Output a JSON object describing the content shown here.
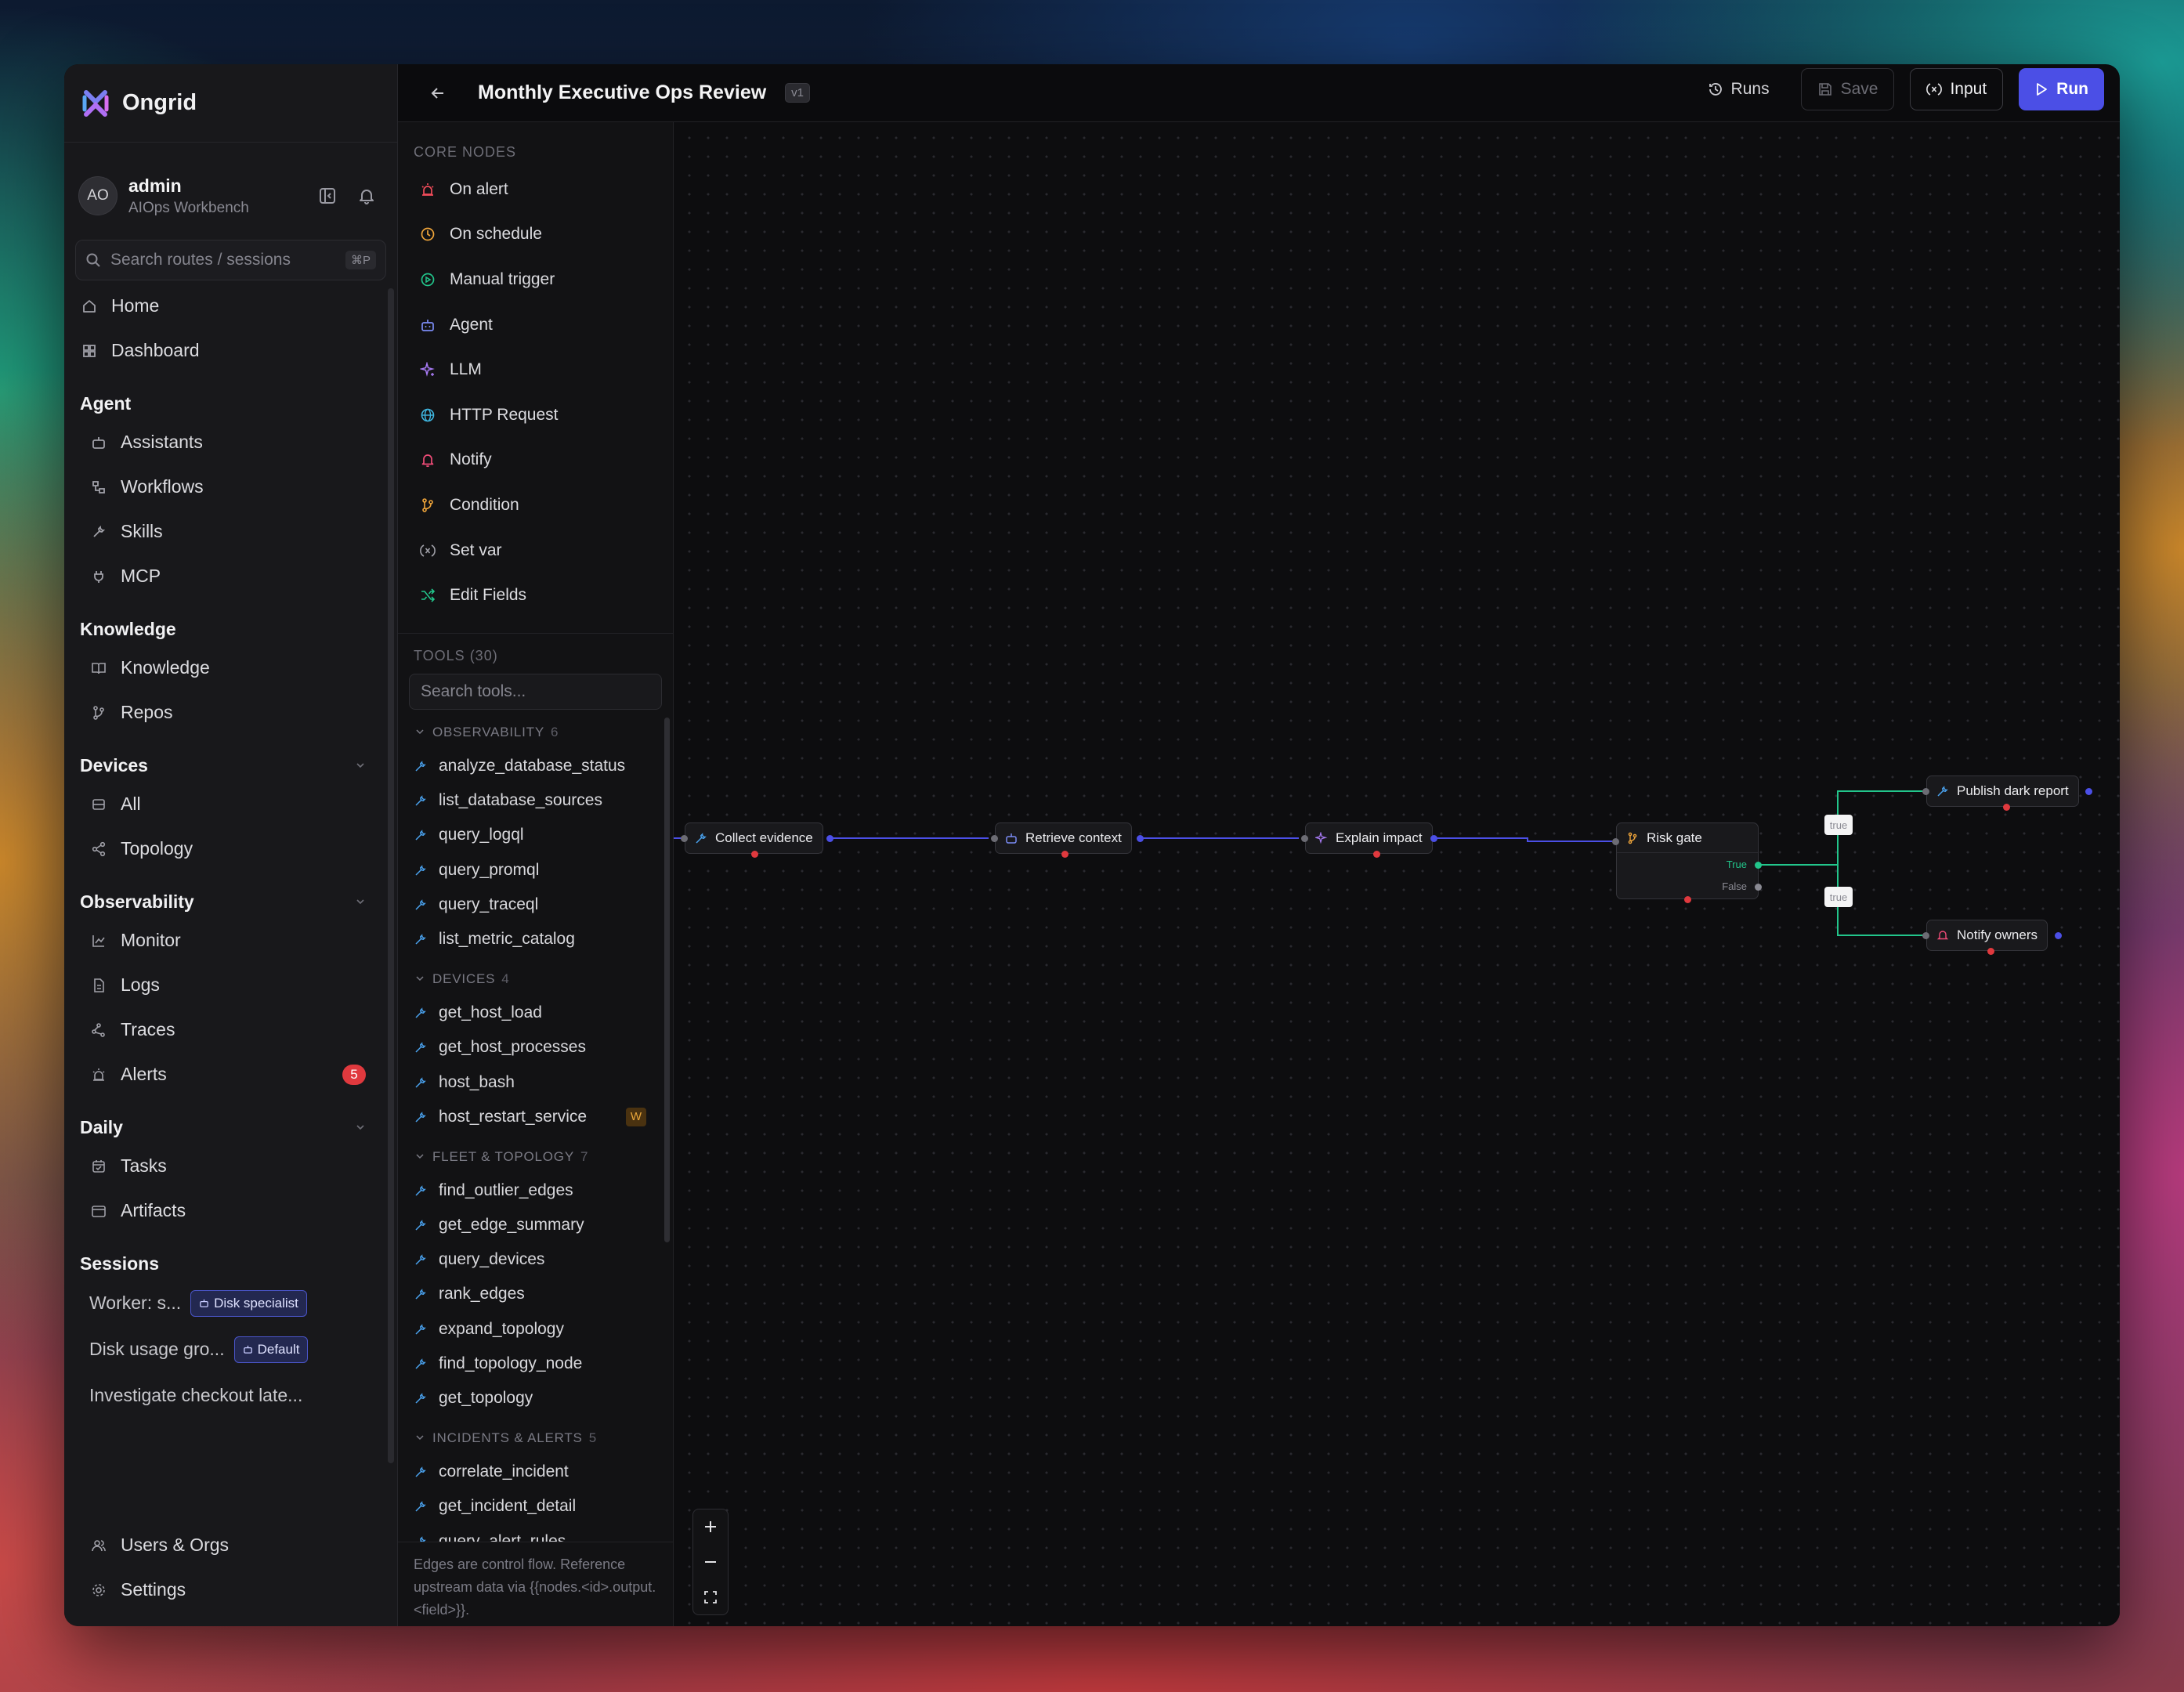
{
  "app": {
    "brand": "Ongrid"
  },
  "user": {
    "initials": "AO",
    "name": "admin",
    "org": "AIOps Workbench"
  },
  "search": {
    "placeholder": "Search routes / sessions",
    "shortcut": "⌘P"
  },
  "nav": {
    "home": "Home",
    "dashboard": "Dashboard",
    "agent_head": "Agent",
    "assistants": "Assistants",
    "workflows": "Workflows",
    "skills": "Skills",
    "mcp": "MCP",
    "knowledge_head": "Knowledge",
    "knowledge": "Knowledge",
    "repos": "Repos",
    "devices_head": "Devices",
    "all": "All",
    "topology": "Topology",
    "observability_head": "Observability",
    "monitor": "Monitor",
    "logs": "Logs",
    "traces": "Traces",
    "alerts": "Alerts",
    "alerts_count": "5",
    "daily_head": "Daily",
    "tasks": "Tasks",
    "artifacts": "Artifacts",
    "sessions_head": "Sessions",
    "users_orgs": "Users & Orgs",
    "settings": "Settings"
  },
  "sessions": [
    {
      "title": "Worker: s...",
      "tag": "Disk specialist"
    },
    {
      "title": "Disk usage gro...",
      "tag": "Default"
    },
    {
      "title": "Investigate checkout late...",
      "tag": ""
    }
  ],
  "workflow": {
    "title": "Monthly Executive Ops Review",
    "version": "v1"
  },
  "toolbar": {
    "runs": "Runs",
    "save": "Save",
    "input": "Input",
    "run": "Run"
  },
  "palette": {
    "core_label": "CORE NODES",
    "core": [
      {
        "label": "On alert",
        "icon": "siren-icon"
      },
      {
        "label": "On schedule",
        "icon": "clock-icon"
      },
      {
        "label": "Manual trigger",
        "icon": "play-circle-icon"
      },
      {
        "label": "Agent",
        "icon": "bot-icon"
      },
      {
        "label": "LLM",
        "icon": "sparkles-icon"
      },
      {
        "label": "HTTP Request",
        "icon": "globe-icon"
      },
      {
        "label": "Notify",
        "icon": "bell-icon"
      },
      {
        "label": "Condition",
        "icon": "git-branch-icon"
      },
      {
        "label": "Set var",
        "icon": "variable-icon"
      },
      {
        "label": "Edit Fields",
        "icon": "shuffle-icon"
      }
    ],
    "tools_label": "TOOLS (30)",
    "tools_search_placeholder": "Search tools...",
    "groups": [
      {
        "name": "OBSERVABILITY",
        "count": "6",
        "tools": [
          "analyze_database_status",
          "list_database_sources",
          "query_logql",
          "query_promql",
          "query_traceql",
          "list_metric_catalog"
        ]
      },
      {
        "name": "DEVICES",
        "count": "4",
        "tools": [
          "get_host_load",
          "get_host_processes",
          "host_bash",
          "host_restart_service"
        ],
        "warn_tool": "W"
      },
      {
        "name": "FLEET & TOPOLOGY",
        "count": "7",
        "tools": [
          "find_outlier_edges",
          "get_edge_summary",
          "query_devices",
          "rank_edges",
          "expand_topology",
          "find_topology_node",
          "get_topology"
        ]
      },
      {
        "name": "INCIDENTS & ALERTS",
        "count": "5",
        "tools": [
          "correlate_incident",
          "get_incident_detail",
          "query_alert_rules"
        ]
      }
    ],
    "footer": "Edges are control flow. Reference upstream data via {{nodes.<id>.output.<field>}}."
  },
  "graph": {
    "nodes": [
      {
        "label": "Collect evidence",
        "icon": "wrench-icon"
      },
      {
        "label": "Retrieve context",
        "icon": "bot-icon"
      },
      {
        "label": "Explain impact",
        "icon": "sparkles-icon"
      },
      {
        "label": "Risk gate",
        "icon": "git-branch-icon",
        "branches": [
          "True",
          "False"
        ]
      },
      {
        "label": "Publish dark report",
        "icon": "wrench-icon"
      },
      {
        "label": "Notify owners",
        "icon": "bell-icon"
      }
    ],
    "edge_labels": [
      "true",
      "true"
    ]
  },
  "colors": {
    "accent": "#4b4fe6",
    "edge": "#4b4fe6",
    "true_edge": "#22c58b",
    "alert_badge": "#e0393e",
    "warn_tag": "#e7a53a"
  }
}
